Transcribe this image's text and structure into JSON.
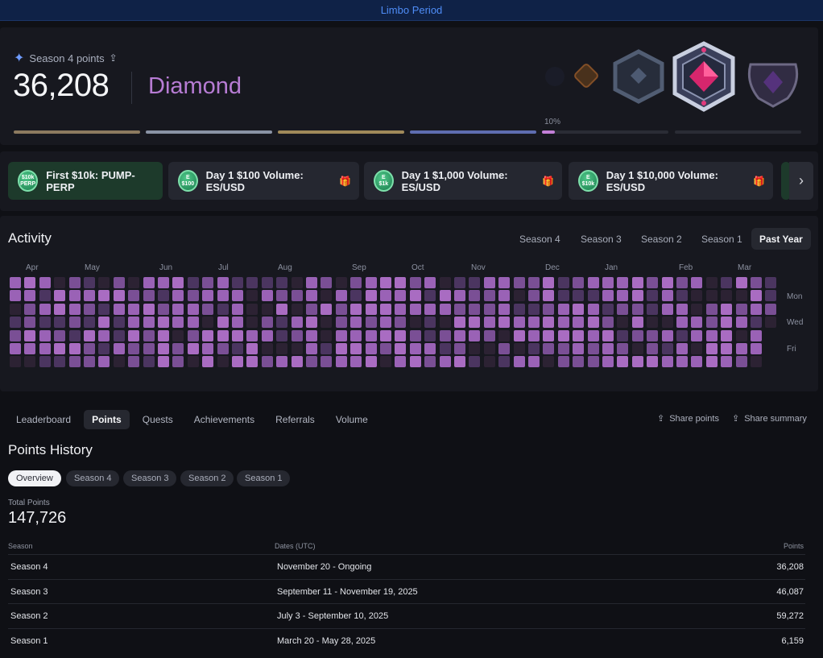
{
  "banner": {
    "text": "Limbo Period"
  },
  "season": {
    "label": "Season 4 points",
    "points": "36,208",
    "tier": "Diamond",
    "progress_label": "10%",
    "progress": [
      {
        "fill": 1.0,
        "color": "#8c7a5f"
      },
      {
        "fill": 1.0,
        "color": "#8a93a5"
      },
      {
        "fill": 1.0,
        "color": "#a08a5a"
      },
      {
        "fill": 1.0,
        "color": "#5e6db0"
      },
      {
        "fill": 0.1,
        "color": "#c27fd8"
      },
      {
        "fill": 0.0,
        "color": "#2a2c35"
      }
    ]
  },
  "quests": [
    {
      "label": "First $10k: PUMP-PERP",
      "coin_top": "$10k",
      "coin_bottom": "PERP",
      "gift": false
    },
    {
      "label": "Day 1 $100 Volume: ES/USD",
      "coin_top": "E",
      "coin_bottom": "$100",
      "gift": true
    },
    {
      "label": "Day 1 $1,000 Volume: ES/USD",
      "coin_top": "E",
      "coin_bottom": "$1k",
      "gift": true
    },
    {
      "label": "Day 1 $10,000 Volume: ES/USD",
      "coin_top": "E",
      "coin_bottom": "$10k",
      "gift": true
    }
  ],
  "activity": {
    "title": "Activity",
    "tabs": [
      "Season 4",
      "Season 3",
      "Season 2",
      "Season 1",
      "Past Year"
    ],
    "active_tab": "Past Year",
    "months": [
      "Apr",
      "May",
      "Jun",
      "Jul",
      "Aug",
      "Sep",
      "Oct",
      "Nov",
      "Dec",
      "Jan",
      "Feb",
      "Mar"
    ],
    "day_labels": [
      "Mon",
      "Wed",
      "Fri"
    ]
  },
  "nav": {
    "tabs": [
      "Leaderboard",
      "Points",
      "Quests",
      "Achievements",
      "Referrals",
      "Volume"
    ],
    "active": "Points",
    "share_points": "Share points",
    "share_summary": "Share summary"
  },
  "history": {
    "title": "Points History",
    "pills": [
      "Overview",
      "Season 4",
      "Season 3",
      "Season 2",
      "Season 1"
    ],
    "active_pill": "Overview",
    "total_label": "Total Points",
    "total_value": "147,726",
    "columns": [
      "Season",
      "Dates (UTC)",
      "Points"
    ],
    "rows": [
      {
        "season": "Season 4",
        "dates": "November 20 - Ongoing",
        "points": "36,208"
      },
      {
        "season": "Season 3",
        "dates": "September 11 - November 19, 2025",
        "points": "46,087"
      },
      {
        "season": "Season 2",
        "dates": "July 3 - September 10, 2025",
        "points": "59,272"
      },
      {
        "season": "Season 1",
        "dates": "March 20 - May 28, 2025",
        "points": "6,159"
      }
    ]
  }
}
